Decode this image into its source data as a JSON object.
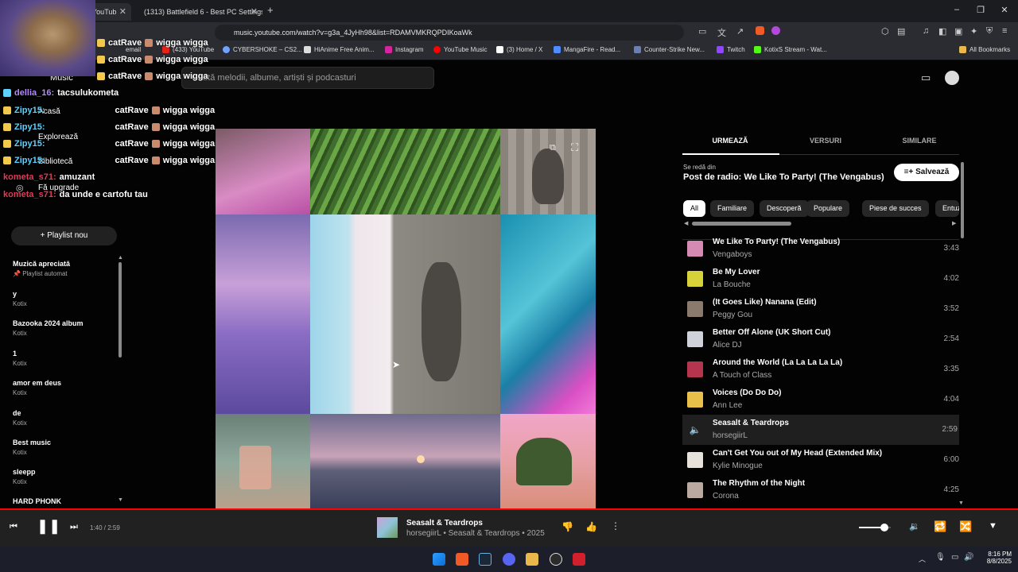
{
  "browser": {
    "tabs": [
      {
        "label": "YouTub"
      },
      {
        "label": "(1313) Battlefield 6 - Best PC Settings"
      }
    ],
    "url": "music.youtube.com/watch?v=g3a_4JyHh98&list=RDAMVMKRQPDIKoaWk",
    "bookmarks": [
      "email",
      "(433) YouTube",
      "CYBERSHOKE – CS2...",
      "HiAnime Free Anim...",
      "Instagram",
      "YouTube Music",
      "(3) Home / X",
      "MangaFire - Read...",
      "Counter-Strike New...",
      "Twitch",
      "KotixS Stream - Wat..."
    ],
    "all_bookmarks": "All Bookmarks"
  },
  "header": {
    "logo": "Music",
    "search_placeholder": "Caută melodii, albume, artiști și podcasturi"
  },
  "sidebar": {
    "nav": [
      "Acasă",
      "Explorează",
      "Bibliotecă",
      "Fă upgrade"
    ],
    "new_playlist": "Playlist nou",
    "playlists": [
      {
        "title": "Muzică apreciată",
        "sub": "Playlist automat"
      },
      {
        "title": "y",
        "sub": "Kotix"
      },
      {
        "title": "Bazooka 2024 album",
        "sub": "Kotix"
      },
      {
        "title": "1",
        "sub": "Kotix"
      },
      {
        "title": "amor em deus",
        "sub": "Kotix"
      },
      {
        "title": "de",
        "sub": "Kotix"
      },
      {
        "title": "Best music",
        "sub": "Kotix"
      },
      {
        "title": "sleepp",
        "sub": "Kotix"
      },
      {
        "title": "HARD PHONK",
        "sub": ""
      }
    ]
  },
  "chat_overlay": {
    "messages": [
      {
        "user": "",
        "text": "catRave",
        "text2": "wigga wigga"
      },
      {
        "user": "",
        "text": "catRave",
        "text2": "wigga wigga"
      },
      {
        "user": "",
        "text": "catRave",
        "text2": "wigga wigga"
      },
      {
        "user": "dellia_16:",
        "text": "tacsulukometa",
        "text2": ""
      },
      {
        "user": "Zipy15:",
        "text": "catRave",
        "text2": "wigga wigga"
      },
      {
        "user": "Zipy15:",
        "text": "catRave",
        "text2": "wigga wigga"
      },
      {
        "user": "Zipy15:",
        "text": "catRave",
        "text2": "wigga wigga"
      },
      {
        "user": "Zipy15:",
        "text": "catRave",
        "text2": "wigga wigga"
      },
      {
        "user": "kometa_s71:",
        "text": "amuzant",
        "text2": ""
      },
      {
        "user": "kometa_s71:",
        "text": "da unde e cartofu tau",
        "text2": ""
      }
    ]
  },
  "queue_panel": {
    "tabs": [
      "URMEAZĂ",
      "VERSURI",
      "SIMILARE"
    ],
    "playing_from_label": "Se redă din",
    "playing_from": "Post de radio: We Like To Party! (The Vengabus)",
    "save": "Salvează",
    "chips": [
      "All",
      "Familiare",
      "Descoperă",
      "Populare",
      "Piese de succes",
      "Entuz"
    ],
    "tracks": [
      {
        "title": "We Like To Party! (The Vengabus)",
        "artist": "Vengaboys",
        "duration": "3:43",
        "color": "#d58ab4"
      },
      {
        "title": "Be My Lover",
        "artist": "La Bouche",
        "duration": "4:02",
        "color": "#d8d23a"
      },
      {
        "title": "(It Goes Like) Nanana (Edit)",
        "artist": "Peggy Gou",
        "duration": "3:52",
        "color": "#8a7a6e"
      },
      {
        "title": "Better Off Alone (UK Short Cut)",
        "artist": "Alice DJ",
        "duration": "2:54",
        "color": "#cfd2d8"
      },
      {
        "title": "Around the World (La La La La La)",
        "artist": "A Touch of Class",
        "duration": "3:35",
        "color": "#b5344e"
      },
      {
        "title": "Voices (Do Do Do)",
        "artist": "Ann Lee",
        "duration": "4:04",
        "color": "#e8c04a"
      },
      {
        "title": "Seasalt & Teardrops",
        "artist": "horsegiirL",
        "duration": "2:59",
        "color": "#2a2a2a"
      },
      {
        "title": "Can't Get You out of My Head (Extended Mix)",
        "artist": "Kylie Minogue",
        "duration": "6:00",
        "color": "#e6e1db"
      },
      {
        "title": "The Rhythm of the Night",
        "artist": "Corona",
        "duration": "4:25",
        "color": "#b9a9a0"
      }
    ]
  },
  "player": {
    "time": "1:40 / 2:59",
    "progress": 0.559,
    "title": "Seasalt & Teardrops",
    "subtitle": "horsegiirL • Seasalt & Teardrops • 2025",
    "volume": 0.8
  },
  "taskbar": {
    "time": "8:16 PM",
    "date": "8/8/2025"
  }
}
